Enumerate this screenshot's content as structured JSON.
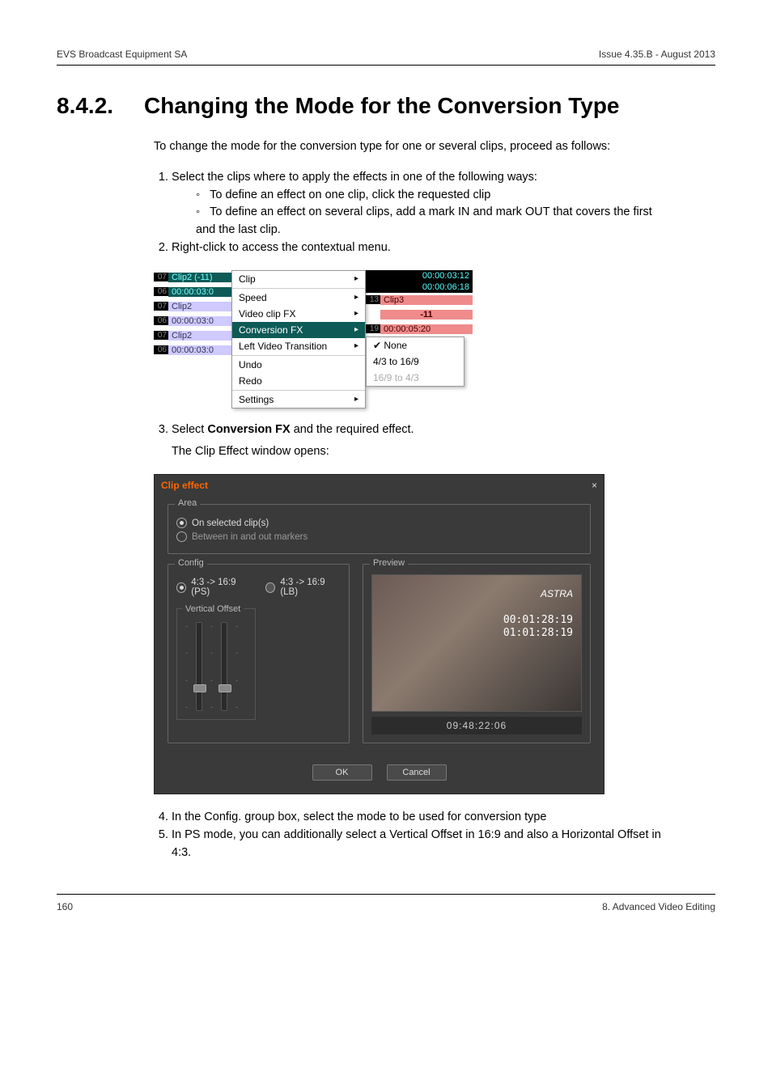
{
  "header": {
    "left": "EVS Broadcast Equipment SA",
    "right": "Issue 4.35.B - August 2013"
  },
  "heading": {
    "num": "8.4.2.",
    "title": "Changing the Mode for the Conversion Type"
  },
  "intro": "To change the mode for the conversion type for one or several clips, proceed as follows:",
  "steps": {
    "s1": "Select the clips where to apply the effects in one of the following ways:",
    "s1a": "To define an effect on one clip, click the requested clip",
    "s1b": "To define an effect on several clips, add a mark IN and mark OUT that covers the first and the last clip.",
    "s2": "Right-click to access the contextual menu.",
    "s3_pre": "Select ",
    "s3_b": "Conversion FX",
    "s3_post": " and the required effect.",
    "s3_sub": "The Clip Effect window opens:",
    "s4": "In the Config. group box, select the mode to be used for conversion type",
    "s5": "In PS mode, you can additionally select a Vertical Offset in 16:9 and also a Horizontal Offset in 4:3."
  },
  "shot1": {
    "tc_top1": "00:00:03:12",
    "tc_top2": "00:00:06:18",
    "l_rows": [
      {
        "n": "07",
        "label": "Clip2 (-11)",
        "cls": "teal"
      },
      {
        "n": "06",
        "label": "00:00:03:0",
        "cls": "teal"
      },
      {
        "n": "07",
        "label": "Clip2",
        "cls": "lav"
      },
      {
        "n": "06",
        "label": "00:00:03:0",
        "cls": "lav"
      },
      {
        "n": "07",
        "label": "Clip2",
        "cls": "lav"
      },
      {
        "n": "06",
        "label": "00:00:03:0",
        "cls": "lav"
      }
    ],
    "menu": [
      {
        "label": "Clip",
        "arrow": true
      },
      {
        "sep": true
      },
      {
        "label": "Speed",
        "arrow": true
      },
      {
        "label": "Video clip FX",
        "arrow": true
      },
      {
        "label": "Conversion FX",
        "arrow": true,
        "sel": true
      },
      {
        "label": "Left Video Transition",
        "arrow": true
      },
      {
        "sep": true
      },
      {
        "label": "Undo"
      },
      {
        "label": "Redo"
      },
      {
        "sep": true
      },
      {
        "label": "Settings",
        "arrow": true
      }
    ],
    "r_rows": [
      {
        "n": "13",
        "label": "Clip3",
        "cls": "pink"
      },
      {
        "n": "",
        "label": "-11",
        "cls": "pink",
        "center": true
      },
      {
        "n": "19",
        "label": "00:00:05:20",
        "cls": "pink"
      }
    ],
    "submenu": [
      {
        "label": "None",
        "chk": true
      },
      {
        "label": "4/3 to 16/9"
      },
      {
        "label": "16/9 to 4/3",
        "dim": true
      }
    ]
  },
  "shot2": {
    "title": "Clip effect",
    "close": "×",
    "area": {
      "legend": "Area",
      "opt1": "On selected clip(s)",
      "opt2": "Between in and out markers"
    },
    "config": {
      "legend": "Config",
      "optA": "4:3 -> 16:9 (PS)",
      "optB": "4:3 -> 16:9 (LB)",
      "voffset": "Vertical Offset"
    },
    "preview": {
      "legend": "Preview",
      "brand": "ASTRA",
      "tc1": "00:01:28:19",
      "tc2": "01:01:28:19",
      "tc_big": "09:48:22:06"
    },
    "ok": "OK",
    "cancel": "Cancel"
  },
  "footer": {
    "left": "160",
    "right": "8. Advanced Video Editing"
  }
}
